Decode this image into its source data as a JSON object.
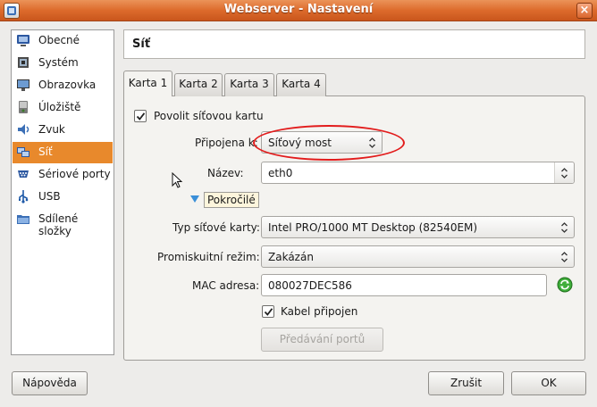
{
  "window": {
    "title": "Webserver - Nastavení",
    "close_glyph": "×"
  },
  "sidebar": {
    "items": [
      {
        "label": "Obecné",
        "icon": "general-icon"
      },
      {
        "label": "Systém",
        "icon": "system-icon"
      },
      {
        "label": "Obrazovka",
        "icon": "display-icon"
      },
      {
        "label": "Úložiště",
        "icon": "storage-icon"
      },
      {
        "label": "Zvuk",
        "icon": "audio-icon"
      },
      {
        "label": "Síť",
        "icon": "network-icon",
        "selected": true
      },
      {
        "label": "Sériové porty",
        "icon": "serial-port-icon"
      },
      {
        "label": "USB",
        "icon": "usb-icon"
      },
      {
        "label": "Sdílené složky",
        "icon": "shared-folder-icon"
      }
    ]
  },
  "header": {
    "title": "Síť"
  },
  "tabs": [
    {
      "label": "Karta 1",
      "active": true
    },
    {
      "label": "Karta 2"
    },
    {
      "label": "Karta 3"
    },
    {
      "label": "Karta 4"
    }
  ],
  "form": {
    "enable_label": "Povolit síťovou kartu",
    "enable_checked": true,
    "attached_label": "Připojena k:",
    "attached_value": "Síťový most",
    "name_label": "Název:",
    "name_value": "eth0",
    "advanced_label": "Pokročilé",
    "adapter_label": "Typ síťové karty:",
    "adapter_value": "Intel PRO/1000 MT Desktop (82540EM)",
    "promisc_label": "Promiskuitní režim:",
    "promisc_value": "Zakázán",
    "mac_label": "MAC adresa:",
    "mac_value": "080027DEC586",
    "cable_label": "Kabel připojen",
    "cable_checked": true,
    "port_forwarding_label": "Předávání portů"
  },
  "footer": {
    "help_label": "Nápověda",
    "cancel_label": "Zrušit",
    "ok_label": "OK"
  },
  "colors": {
    "selection": "#e8892c",
    "titlebar": "#dd6b2c",
    "annotation": "#e21c1c"
  }
}
